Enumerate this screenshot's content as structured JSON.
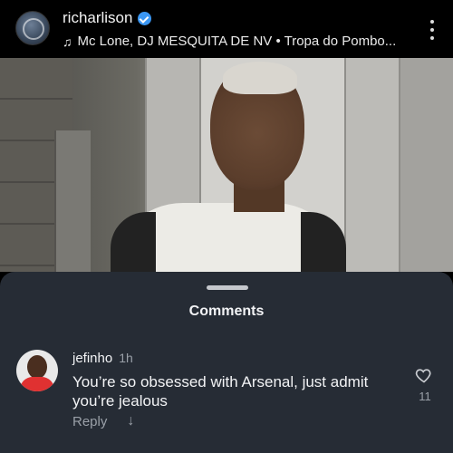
{
  "header": {
    "username": "richarlison",
    "verified_icon": "verified-badge-icon",
    "music": "Mc Lone, DJ MESQUITA DE NV • Tropa do Pombo...",
    "music_icon": "music-note-icon",
    "more_icon": "more-vertical-icon"
  },
  "sheet": {
    "title": "Comments"
  },
  "comment": {
    "username": "jefinho",
    "time": "1h",
    "text": "You’re so obsessed with Arsenal, just admit you’re jealous",
    "reply_label": "Reply",
    "like_count": "11",
    "like_icon": "heart-icon",
    "more_icon": "arrow-down-icon"
  },
  "colors": {
    "sheet_bg": "#262c35",
    "verified": "#3b97f3",
    "muted": "#9aa0a8"
  }
}
